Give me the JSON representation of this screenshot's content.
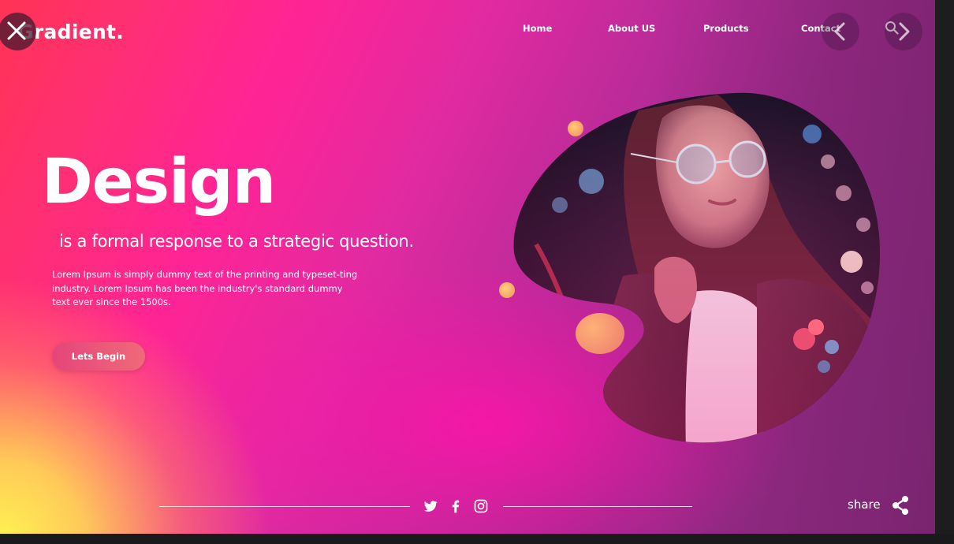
{
  "brand": {
    "logo_text": "Gradient."
  },
  "nav": {
    "items": [
      {
        "label": "Home"
      },
      {
        "label": "About US"
      },
      {
        "label": "Products"
      },
      {
        "label": "Contact"
      }
    ]
  },
  "viewer_controls": {
    "close_icon": "close-icon",
    "prev_icon": "chevron-left-icon",
    "next_icon": "chevron-right-icon",
    "search_icon": "search-icon"
  },
  "hero": {
    "title": "Design",
    "subtitle": "is a formal response to a strategic question.",
    "body": "Lorem Ipsum is simply dummy text of the printing and typeset-ting industry. Lorem Ipsum has been the industry's standard dummy text ever since the 1500s.",
    "cta_label": "Lets Begin"
  },
  "footer": {
    "social": [
      "twitter-icon",
      "facebook-icon",
      "instagram-icon"
    ],
    "share_label": "share",
    "share_icon": "share-icon"
  },
  "colors": {
    "gradient_pink": "#ff2495",
    "gradient_purple": "#8a2a80",
    "gradient_yellow": "#fff850",
    "gradient_red": "#ff3355",
    "cta": "#e5457a",
    "accent_orange": "#f28a6f"
  }
}
